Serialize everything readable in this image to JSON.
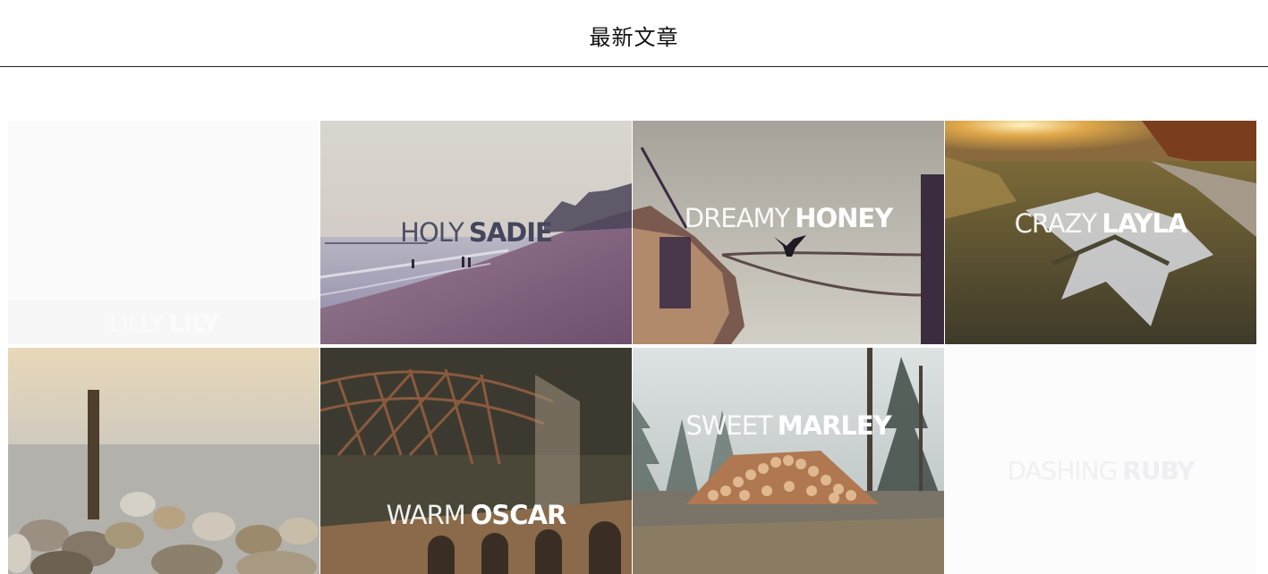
{
  "header": {
    "title": "最新文章"
  },
  "articles": [
    {
      "light": "LILLY",
      "bold": "LILY"
    },
    {
      "light": "HOLY",
      "bold": "SADIE"
    },
    {
      "light": "DREAMY",
      "bold": "HONEY"
    },
    {
      "light": "CRAZY",
      "bold": "LAYLA"
    },
    {
      "light": "",
      "bold": ""
    },
    {
      "light": "WARM",
      "bold": "OSCAR"
    },
    {
      "light": "SWEET",
      "bold": "MARLEY"
    },
    {
      "light": "DASHING",
      "bold": "RUBY"
    }
  ]
}
